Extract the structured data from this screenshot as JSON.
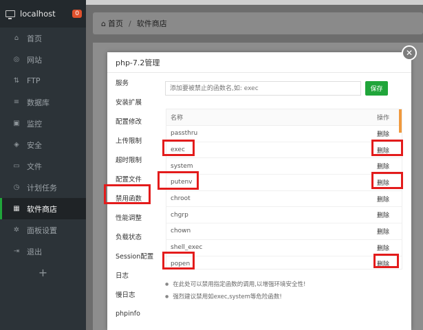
{
  "sidebar": {
    "host": "localhost",
    "badge": "0",
    "items": [
      {
        "label": "首页",
        "icon": "home-icon",
        "glyph": "⌂"
      },
      {
        "label": "网站",
        "icon": "globe-icon",
        "glyph": "◎"
      },
      {
        "label": "FTP",
        "icon": "ftp-icon",
        "glyph": "⇅"
      },
      {
        "label": "数据库",
        "icon": "database-icon",
        "glyph": "≡"
      },
      {
        "label": "监控",
        "icon": "monitor-icon",
        "glyph": "▣"
      },
      {
        "label": "安全",
        "icon": "shield-icon",
        "glyph": "◈"
      },
      {
        "label": "文件",
        "icon": "folder-icon",
        "glyph": "▭"
      },
      {
        "label": "计划任务",
        "icon": "clock-icon",
        "glyph": "◷"
      },
      {
        "label": "软件商店",
        "icon": "grid-icon",
        "glyph": "▦"
      },
      {
        "label": "面板设置",
        "icon": "gear-icon",
        "glyph": "✲"
      },
      {
        "label": "退出",
        "icon": "logout-icon",
        "glyph": "⇥"
      }
    ],
    "add_glyph": "+"
  },
  "breadcrumb": {
    "home": "首页",
    "sep": "/",
    "current": "软件商店"
  },
  "dialog": {
    "title": "php-7.2管理",
    "close_glyph": "✕",
    "tabs": [
      "服务",
      "安装扩展",
      "配置修改",
      "上传限制",
      "超时限制",
      "配置文件",
      "禁用函数",
      "性能调整",
      "负载状态",
      "Session配置",
      "日志",
      "慢日志",
      "phpinfo"
    ],
    "input_placeholder": "添加要被禁止的函数名,如: exec",
    "save_label": "保存",
    "table": {
      "col_name": "名称",
      "col_op": "操作",
      "rows": [
        {
          "name": "passthru",
          "op": "删除"
        },
        {
          "name": "exec",
          "op": "删除"
        },
        {
          "name": "system",
          "op": "删除"
        },
        {
          "name": "putenv",
          "op": "删除"
        },
        {
          "name": "chroot",
          "op": "删除"
        },
        {
          "name": "chgrp",
          "op": "删除"
        },
        {
          "name": "chown",
          "op": "删除"
        },
        {
          "name": "shell_exec",
          "op": "删除"
        },
        {
          "name": "popen",
          "op": "删除"
        }
      ]
    },
    "tips": [
      "在此处可以禁用指定函数的调用,以增强环境安全性!",
      "强烈建议禁用如exec,system等危险函数!"
    ]
  },
  "colors": {
    "accent": "#20a53a",
    "highlight": "#e31b1b",
    "badge": "#e0512d"
  }
}
